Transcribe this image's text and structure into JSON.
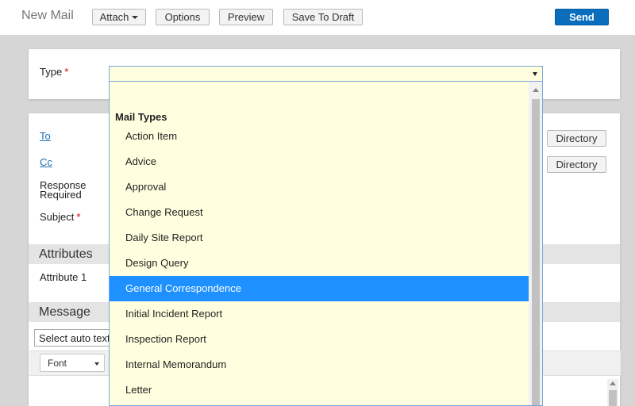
{
  "header": {
    "title": "New Mail",
    "attach_label": "Attach",
    "options_label": "Options",
    "preview_label": "Preview",
    "save_draft_label": "Save To Draft",
    "send_label": "Send"
  },
  "form": {
    "type_label": "Type",
    "to_label": "To",
    "cc_label": "Cc",
    "response_required_line1": "Response",
    "response_required_line2": "Required",
    "subject_label": "Subject",
    "required_marker": "*",
    "directory_label": "Directory"
  },
  "sections": {
    "attributes_title": "Attributes",
    "attribute1_label": "Attribute 1",
    "message_title": "Message"
  },
  "message": {
    "autotext_value": "Select auto text",
    "font_label": "Font"
  },
  "dropdown": {
    "group_label": "Mail Types",
    "items": [
      "Action Item",
      "Advice",
      "Approval",
      "Change Request",
      "Daily Site Report",
      "Design Query",
      "General Correspondence",
      "Initial Incident Report",
      "Inspection Report",
      "Internal Memorandum",
      "Letter"
    ],
    "selected": "General Correspondence"
  },
  "colors": {
    "accent": "#0a6ebd",
    "highlight": "#1e90ff",
    "field_bg": "#ffffe0",
    "required": "#d0021b"
  }
}
